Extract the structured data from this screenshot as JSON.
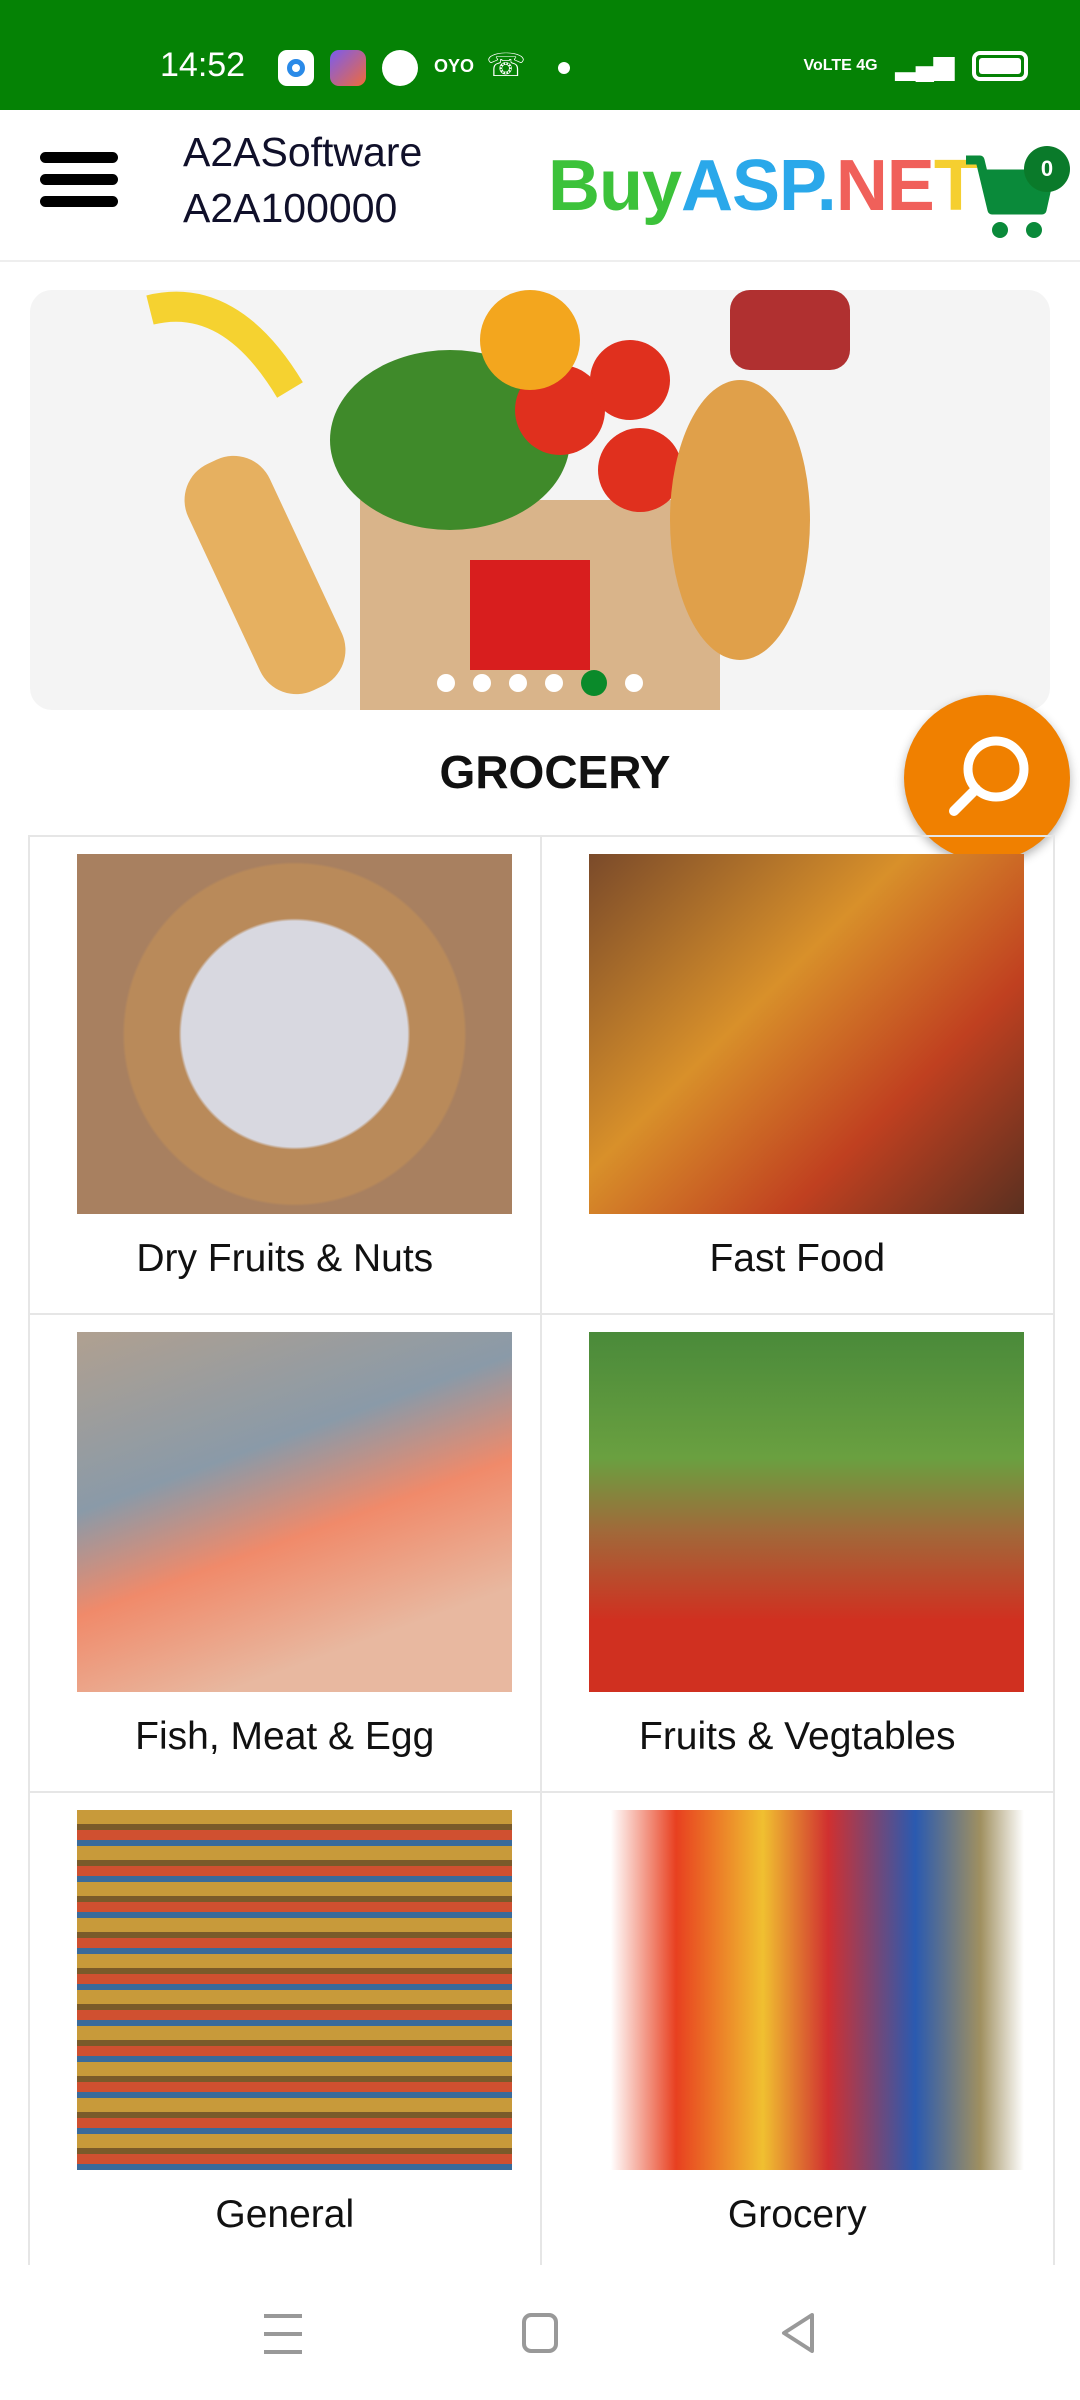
{
  "status_bar": {
    "time": "14:52",
    "icons": [
      "circle-app-icon",
      "shortcut-app-icon",
      "clover-icon",
      "oyo-icon",
      "missed-call-icon",
      "dot-icon"
    ],
    "oyo_text": "OYO",
    "network": "VoLTE 4G",
    "right_icons": [
      "signal-icon",
      "signal-icon",
      "battery-icon"
    ]
  },
  "header": {
    "company": "A2ASoftware",
    "code": "A2A100000",
    "logo": {
      "part1": "Buy",
      "part2": "ASP",
      "part3": ".",
      "part4": "NE",
      "part5": "T"
    },
    "cart_count": "0"
  },
  "colors": {
    "status_bar": "#058205",
    "accent": "#0a8a2a",
    "fab": "#f08000",
    "logo_green": "#3cc23a",
    "logo_blue": "#2aa8ea",
    "logo_red": "#f0605a",
    "logo_yellow": "#f5cf30"
  },
  "banner": {
    "slides": 6,
    "active_slide": 5
  },
  "section_title": "GROCERY",
  "categories": [
    {
      "label": "Dry Fruits & Nuts"
    },
    {
      "label": "Fast Food"
    },
    {
      "label": "Fish, Meat & Egg"
    },
    {
      "label": "Fruits & Vegtables"
    },
    {
      "label": "General"
    },
    {
      "label": "Grocery"
    }
  ]
}
